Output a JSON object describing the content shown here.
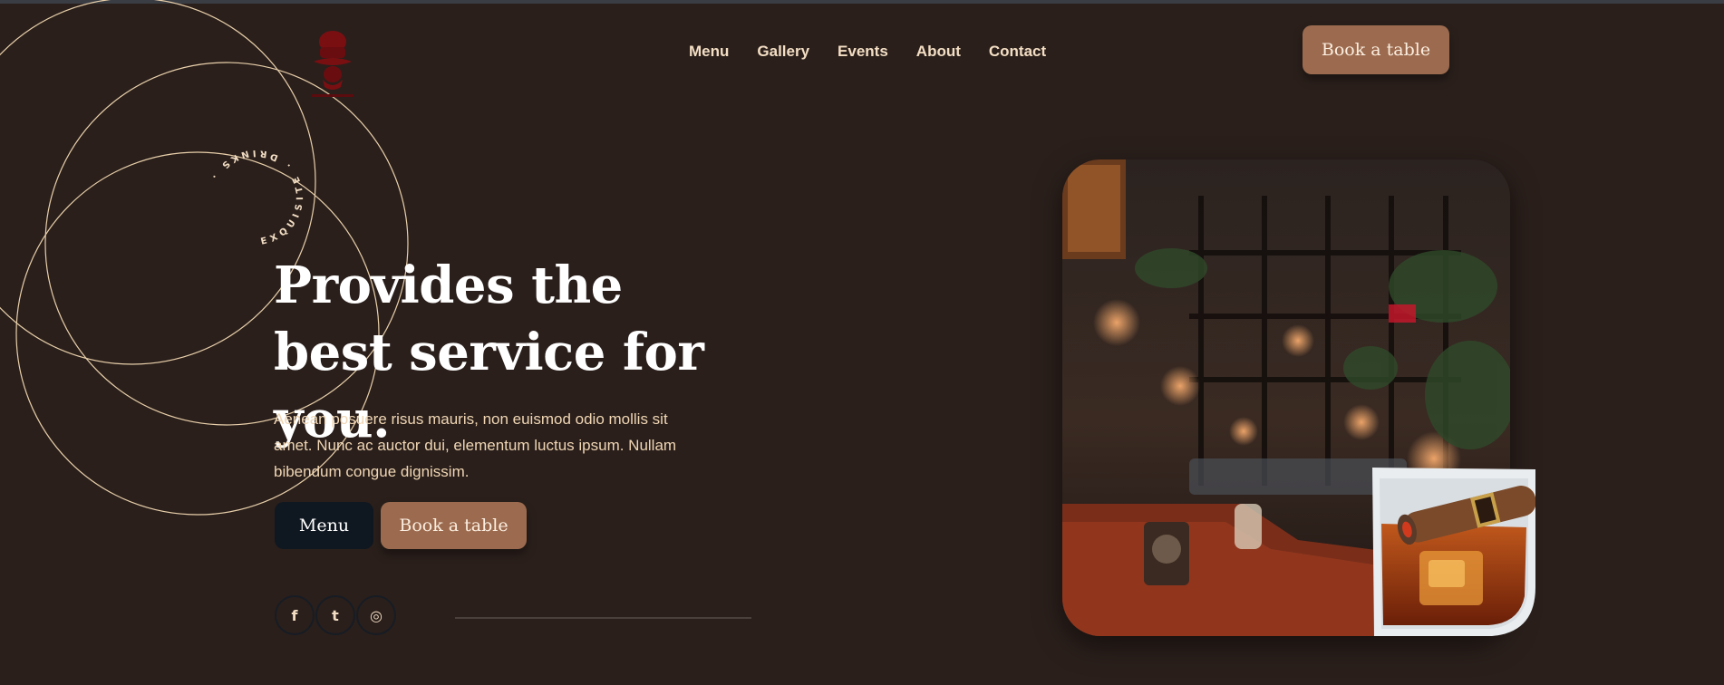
{
  "nav": {
    "items": [
      "Menu",
      "Gallery",
      "Events",
      "About",
      "Contact"
    ],
    "book_label": "Book a table"
  },
  "badge": {
    "circular_text": "EXQUISITE . DRINKS ."
  },
  "hero": {
    "title": "Provides the best service for you.",
    "description": "Aenean posuere risus mauris, non euismod odio mollis sit amet. Nunc ac auctor dui, elementum luctus ipsum. Nullam bibendum congue dignissim.",
    "menu_label": "Menu",
    "book_label": "Book a table"
  },
  "social": {
    "icons": [
      "facebook-icon",
      "twitter-icon",
      "instagram-icon"
    ],
    "glyphs": [
      "f",
      "t",
      "◎"
    ]
  },
  "colors": {
    "background": "#2a1f1b",
    "accent": "#9c6b4f",
    "dark_button": "#0f1720",
    "text_cream": "#f0d6b4",
    "logo_red": "#7a0f12"
  }
}
